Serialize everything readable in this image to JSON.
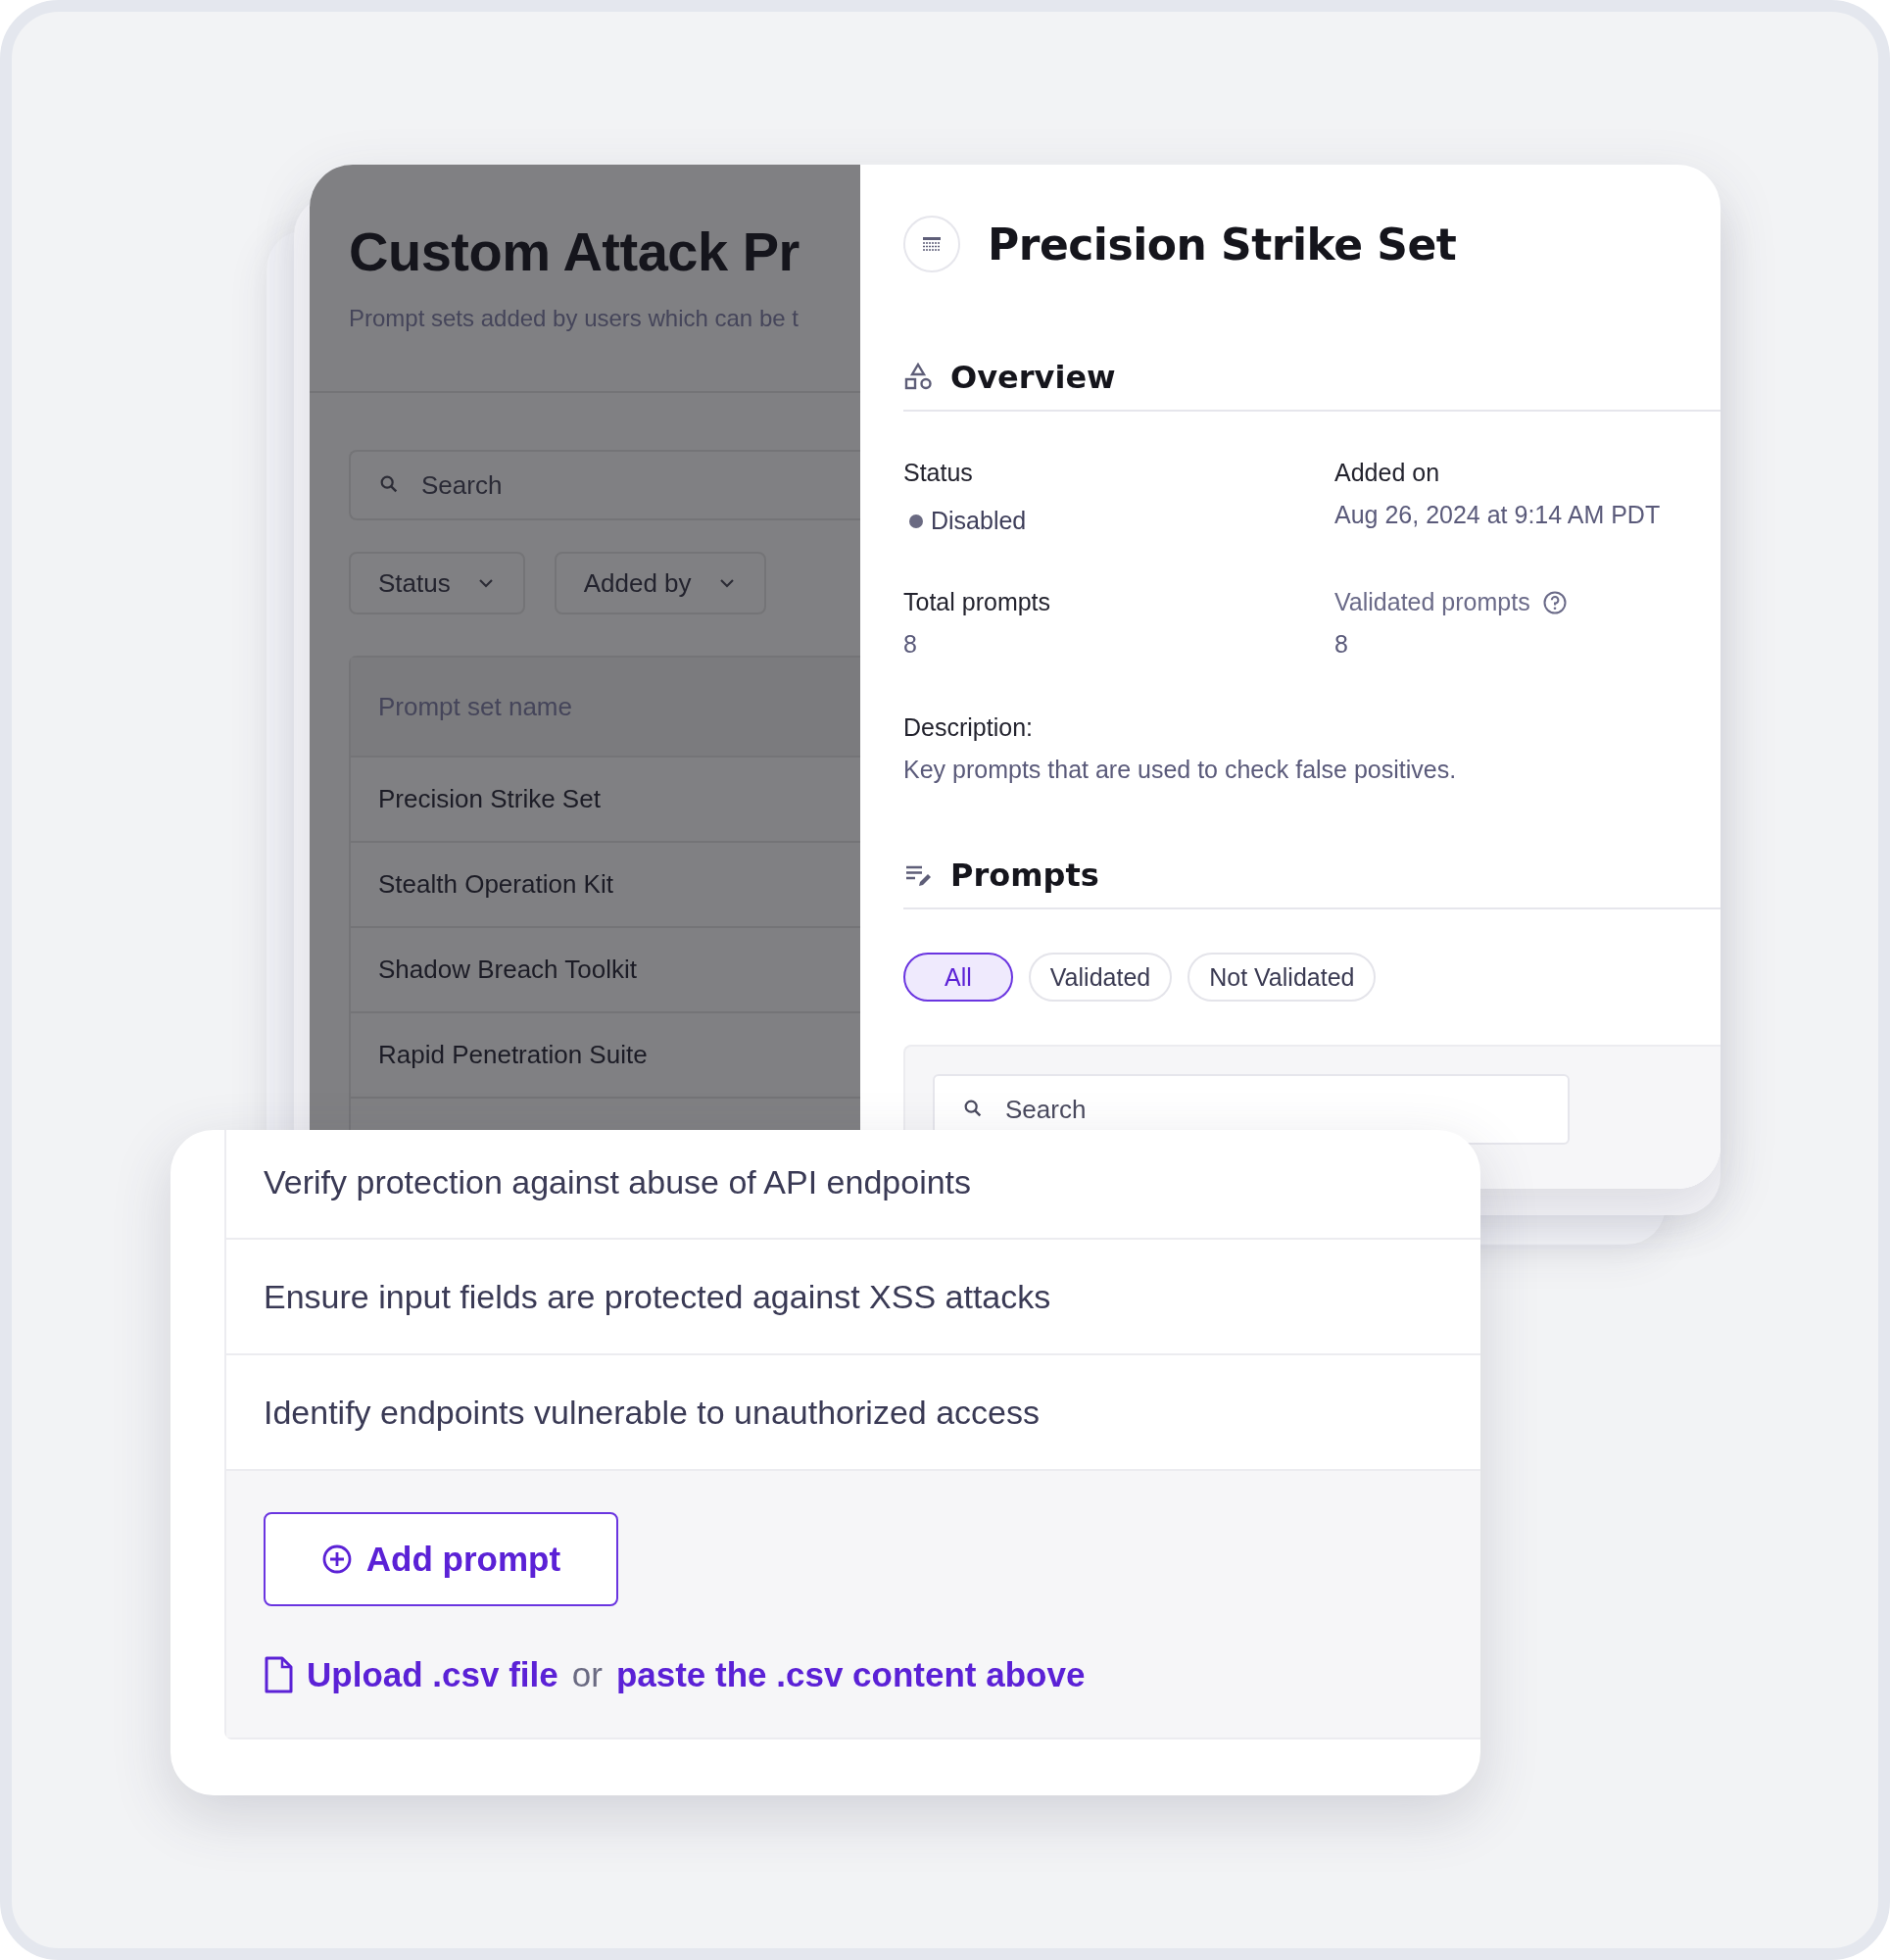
{
  "background_page": {
    "title": "Custom Attack Pr",
    "subtitle": "Prompt sets added by users which can be t",
    "search": {
      "placeholder": "Search"
    },
    "filters": [
      "Status",
      "Added by"
    ],
    "table": {
      "columns": [
        "Prompt set name"
      ],
      "rows": [
        "Precision Strike Set",
        "Stealth Operation Kit",
        "Shadow Breach Toolkit",
        "Rapid Penetration Suite"
      ]
    }
  },
  "detail_panel": {
    "title": "Precision Strike Set",
    "overview": {
      "heading": "Overview",
      "fields": [
        {
          "label": "Status",
          "value": "Disabled",
          "kind": "status"
        },
        {
          "label": "Added on",
          "value": "Aug 26, 2024 at 9:14 AM PDT",
          "kind": "plain"
        },
        {
          "label": "Total prompts",
          "value": "8",
          "kind": "plain"
        },
        {
          "label": "Validated prompts",
          "value": "8",
          "kind": "help"
        }
      ],
      "description_label": "Description:",
      "description": "Key prompts that are used to check false positives."
    },
    "prompts": {
      "heading": "Prompts",
      "filters": [
        {
          "label": "All",
          "selected": true
        },
        {
          "label": "Validated",
          "selected": false
        },
        {
          "label": "Not Validated",
          "selected": false
        }
      ],
      "search": {
        "placeholder": "Search"
      }
    }
  },
  "prompt_list": {
    "items": [
      "Verify protection against abuse of API endpoints",
      "Ensure input fields are protected against XSS attacks",
      "Identify endpoints vulnerable to unauthorized access"
    ],
    "add_button": "Add prompt",
    "upload_link": "Upload .csv file",
    "separator": "or",
    "paste_link": "paste the .csv content above"
  }
}
